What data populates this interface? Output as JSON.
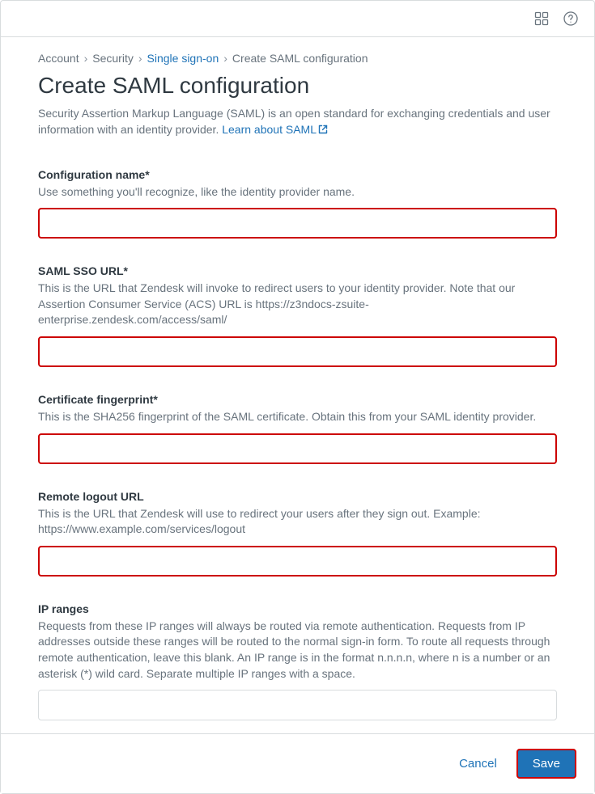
{
  "breadcrumb": {
    "items": [
      {
        "label": "Account"
      },
      {
        "label": "Security"
      },
      {
        "label": "Single sign-on",
        "active": true
      },
      {
        "label": "Create SAML configuration"
      }
    ]
  },
  "page": {
    "title": "Create SAML configuration",
    "description": "Security Assertion Markup Language (SAML) is an open standard for exchanging credentials and user information with an identity provider. ",
    "learn_link": "Learn about SAML"
  },
  "fields": {
    "config_name": {
      "label": "Configuration name*",
      "hint": "Use something you'll recognize, like the identity provider name.",
      "value": ""
    },
    "sso_url": {
      "label": "SAML SSO URL*",
      "hint": "This is the URL that Zendesk will invoke to redirect users to your identity provider. Note that our Assertion Consumer Service (ACS) URL is https://z3ndocs-zsuite-enterprise.zendesk.com/access/saml/",
      "value": ""
    },
    "cert_fp": {
      "label": "Certificate fingerprint*",
      "hint": "This is the SHA256 fingerprint of the SAML certificate. Obtain this from your SAML identity provider.",
      "value": ""
    },
    "logout_url": {
      "label": "Remote logout URL",
      "hint": "This is the URL that Zendesk will use to redirect your users after they sign out. Example: https://www.example.com/services/logout",
      "value": ""
    },
    "ip_ranges": {
      "label": "IP ranges",
      "hint": "Requests from these IP ranges will always be routed via remote authentication. Requests from IP addresses outside these ranges will be routed to the normal sign-in form. To route all requests through remote authentication, leave this blank. An IP range is in the format n.n.n.n, where n is a number or an asterisk (*) wild card. Separate multiple IP ranges with a space.",
      "value": ""
    }
  },
  "footer": {
    "cancel": "Cancel",
    "save": "Save"
  }
}
